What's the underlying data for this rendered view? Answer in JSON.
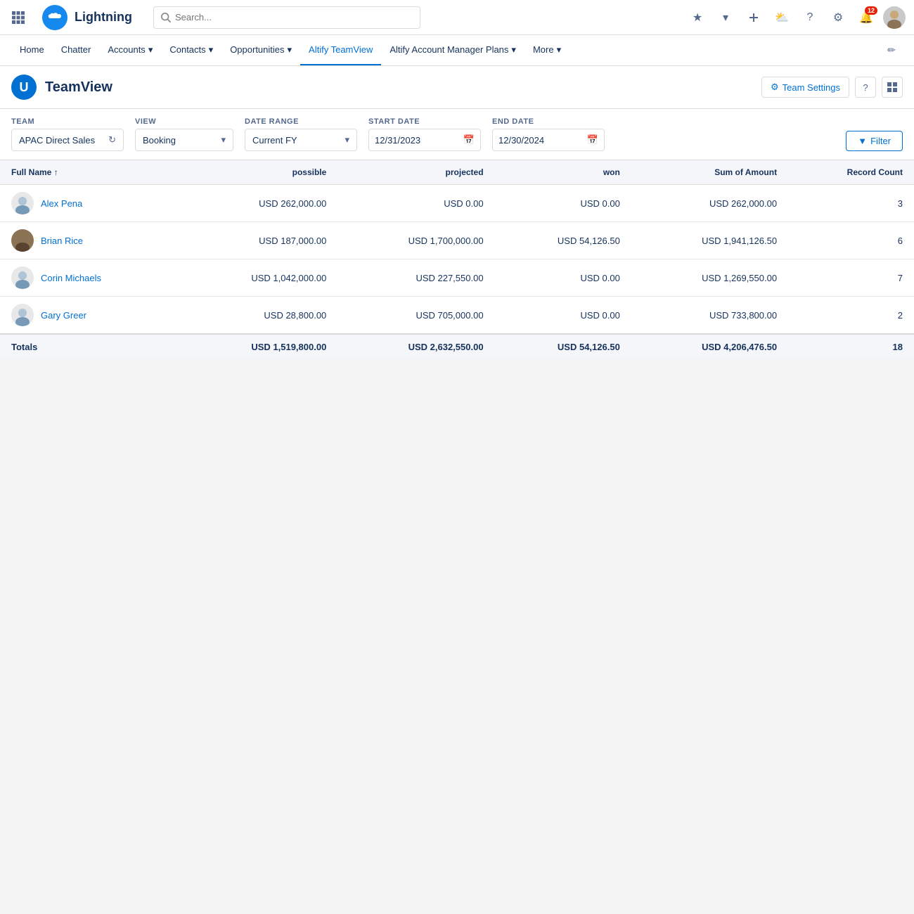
{
  "topNav": {
    "appName": "Lightning",
    "searchPlaceholder": "Search...",
    "navItems": [
      {
        "label": "Home",
        "hasDropdown": false
      },
      {
        "label": "Chatter",
        "hasDropdown": false
      },
      {
        "label": "Accounts",
        "hasDropdown": true
      },
      {
        "label": "Contacts",
        "hasDropdown": true
      },
      {
        "label": "Opportunities",
        "hasDropdown": true
      },
      {
        "label": "Altify TeamView",
        "hasDropdown": false,
        "active": true
      },
      {
        "label": "Altify Account Manager Plans",
        "hasDropdown": true
      },
      {
        "label": "More",
        "hasDropdown": true
      }
    ],
    "notifCount": "12"
  },
  "pageHeader": {
    "iconLabel": "U",
    "title": "TeamView",
    "teamSettingsLabel": "Team Settings",
    "helpLabel": "?"
  },
  "filters": {
    "teamLabel": "Team",
    "teamValue": "APAC Direct Sales",
    "viewLabel": "View",
    "viewValue": "Booking",
    "dateRangeLabel": "Date Range",
    "dateRangeValue": "Current FY",
    "startDateLabel": "Start Date",
    "startDateValue": "12/31/2023",
    "endDateLabel": "End Date",
    "endDateValue": "12/30/2024",
    "filterButtonLabel": "Filter"
  },
  "table": {
    "columns": [
      {
        "key": "name",
        "label": "Full Name",
        "sortable": true,
        "align": "left"
      },
      {
        "key": "possible",
        "label": "possible",
        "align": "right"
      },
      {
        "key": "projected",
        "label": "projected",
        "align": "right"
      },
      {
        "key": "won",
        "label": "won",
        "align": "right"
      },
      {
        "key": "sumAmount",
        "label": "Sum of Amount",
        "align": "right"
      },
      {
        "key": "recordCount",
        "label": "Record Count",
        "align": "right"
      }
    ],
    "rows": [
      {
        "name": "Alex Pena",
        "possible": "USD 262,000.00",
        "projected": "USD 0.00",
        "won": "USD 0.00",
        "sumAmount": "USD 262,000.00",
        "recordCount": "3",
        "avatarType": "generic"
      },
      {
        "name": "Brian Rice",
        "possible": "USD 187,000.00",
        "projected": "USD 1,700,000.00",
        "won": "USD 54,126.50",
        "sumAmount": "USD 1,941,126.50",
        "recordCount": "6",
        "avatarType": "brian"
      },
      {
        "name": "Corin Michaels",
        "possible": "USD 1,042,000.00",
        "projected": "USD 227,550.00",
        "won": "USD 0.00",
        "sumAmount": "USD 1,269,550.00",
        "recordCount": "7",
        "avatarType": "generic"
      },
      {
        "name": "Gary Greer",
        "possible": "USD 28,800.00",
        "projected": "USD 705,000.00",
        "won": "USD 0.00",
        "sumAmount": "USD 733,800.00",
        "recordCount": "2",
        "avatarType": "generic"
      }
    ],
    "totals": {
      "label": "Totals",
      "possible": "USD 1,519,800.00",
      "projected": "USD 2,632,550.00",
      "won": "USD 54,126.50",
      "sumAmount": "USD 4,206,476.50",
      "recordCount": "18"
    }
  },
  "colors": {
    "salesforceBlue": "#1589ee",
    "primaryBlue": "#0070d2",
    "activeTab": "#0070d2",
    "headerBg": "#f4f6f9"
  }
}
